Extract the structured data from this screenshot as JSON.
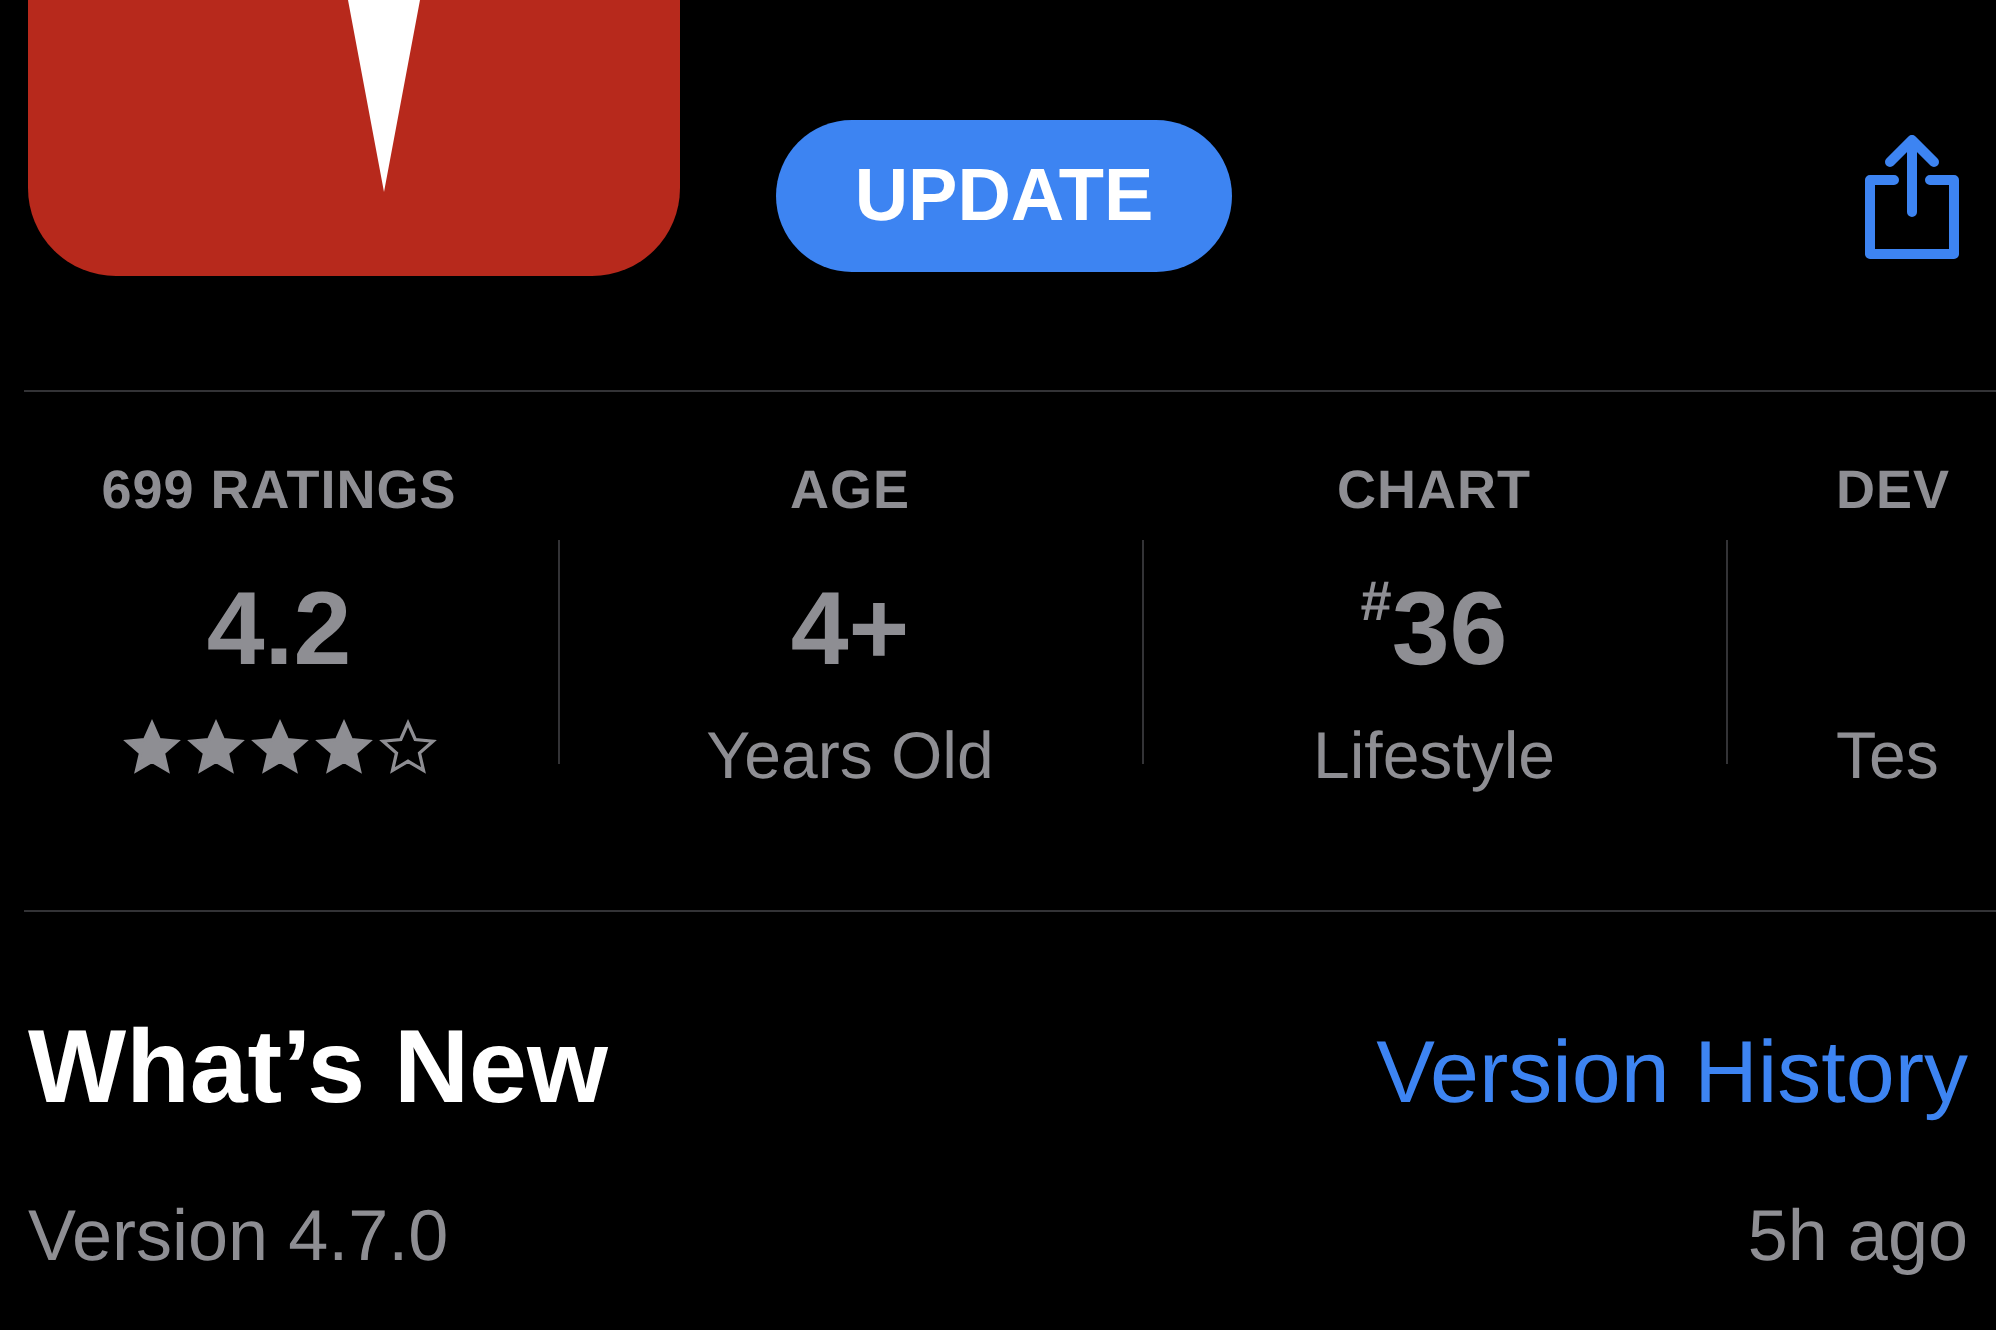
{
  "header": {
    "update_button": "UPDATE"
  },
  "info": [
    {
      "label": "699 RATINGS",
      "value": "4.2",
      "stars": 4,
      "kind": "rating"
    },
    {
      "label": "AGE",
      "value": "4+",
      "sub": "Years Old",
      "kind": "text"
    },
    {
      "label": "CHART",
      "value": "$^{#}$36",
      "sub": "Lifestyle",
      "kind": "text"
    },
    {
      "label": "DEV",
      "sub": "Tes",
      "kind": "text"
    }
  ],
  "whats_new": {
    "title": "What’s New",
    "link": "Version History",
    "version": "Version 4.7.0",
    "time": "5h ago"
  }
}
